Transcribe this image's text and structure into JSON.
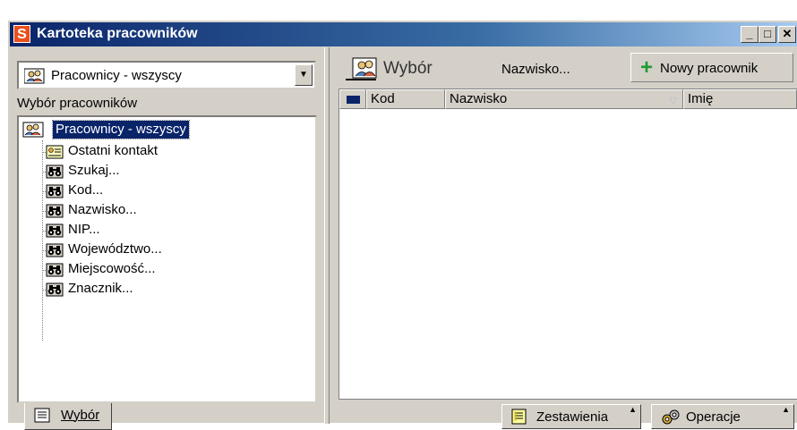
{
  "window": {
    "app_icon_letter": "S",
    "title": "Kartoteka pracowników",
    "minimize_label": "_",
    "maximize_label": "□",
    "close_label": "✕"
  },
  "left": {
    "combo": {
      "value": "Pracownicy - wszyscy",
      "arrow": "▼"
    },
    "section_label": "Wybór pracowników",
    "tree": {
      "root": "Pracownicy - wszyscy",
      "items": [
        {
          "label": "Ostatni kontakt",
          "icon": "contact-card-icon"
        },
        {
          "label": "Szukaj...",
          "icon": "binoculars-icon"
        },
        {
          "label": "Kod...",
          "icon": "binoculars-icon"
        },
        {
          "label": "Nazwisko...",
          "icon": "binoculars-icon"
        },
        {
          "label": "NIP...",
          "icon": "binoculars-icon"
        },
        {
          "label": "Województwo...",
          "icon": "binoculars-icon"
        },
        {
          "label": "Miejscowość...",
          "icon": "binoculars-icon"
        },
        {
          "label": "Znacznik...",
          "icon": "binoculars-icon"
        }
      ]
    },
    "tab": {
      "label": "Wybór"
    }
  },
  "right": {
    "selection_button": "Wybór",
    "search_field_label": "Nazwisko...",
    "new_button": "Nowy pracownik",
    "columns": {
      "kod": "Kod",
      "nazwisko": "Nazwisko",
      "imie": "Imię"
    },
    "bottom": {
      "reports": "Zestawienia",
      "operations": "Operacje"
    }
  },
  "colors": {
    "title_bar": "#0a246a",
    "selection": "#0a246a",
    "window_face": "#d4d0c8",
    "new_plus": "#1f9a34"
  }
}
